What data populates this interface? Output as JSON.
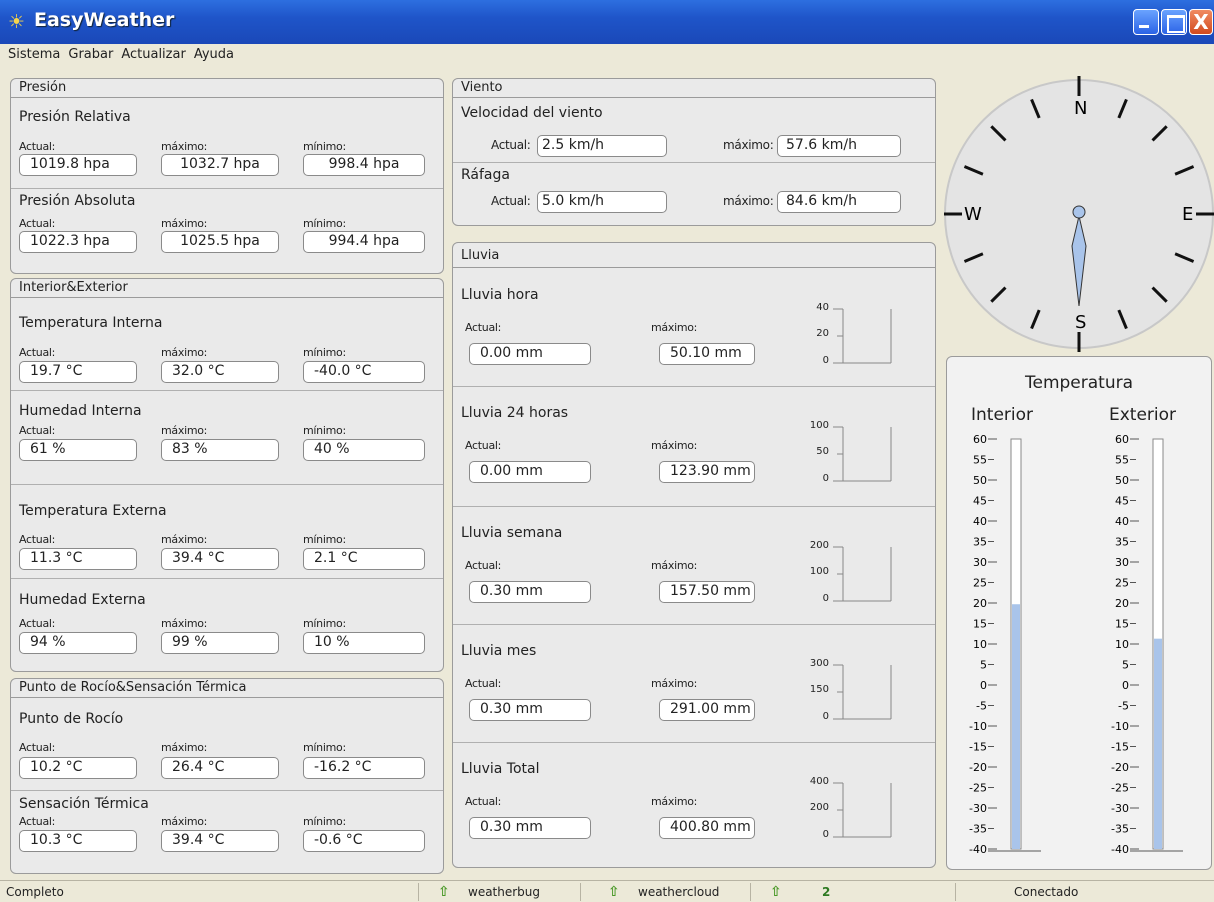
{
  "window": {
    "title": "EasyWeather",
    "close_glyph": "X"
  },
  "menu": [
    "Sistema",
    "Grabar",
    "Actualizar",
    "Ayuda"
  ],
  "labels": {
    "actual": "Actual:",
    "max": "máximo:",
    "min": "mínimo:"
  },
  "presion": {
    "title": "Presión",
    "relativa": {
      "title": "Presión Relativa",
      "actual": "1019.8 hpa",
      "max": "1032.7 hpa",
      "min": "998.4 hpa"
    },
    "absoluta": {
      "title": "Presión Absoluta",
      "actual": "1022.3 hpa",
      "max": "1025.5 hpa",
      "min": "994.4 hpa"
    }
  },
  "interior_exterior": {
    "title": "Interior&Exterior",
    "temp_int": {
      "title": "Temperatura Interna",
      "actual": "19.7 °C",
      "max": "32.0 °C",
      "min": "-40.0 °C"
    },
    "hum_int": {
      "title": "Humedad Interna",
      "actual": "61 %",
      "max": "83 %",
      "min": "40 %"
    },
    "temp_ext": {
      "title": "Temperatura Externa",
      "actual": "11.3 °C",
      "max": "39.4 °C",
      "min": "2.1 °C"
    },
    "hum_ext": {
      "title": "Humedad Externa",
      "actual": "94 %",
      "max": "99 %",
      "min": "10 %"
    }
  },
  "rocio": {
    "title": "Punto de Rocío&Sensación Térmica",
    "punto": {
      "title": "Punto de Rocío",
      "actual": "10.2 °C",
      "max": "26.4 °C",
      "min": "-16.2 °C"
    },
    "sensacion": {
      "title": "Sensación Térmica",
      "actual": "10.3 °C",
      "max": "39.4 °C",
      "min": "-0.6 °C"
    }
  },
  "viento": {
    "title": "Viento",
    "vel_title": "Velocidad del viento",
    "vel_actual": "2.5 km/h",
    "vel_max": "57.6 km/h",
    "raf_title": "Ráfaga",
    "raf_actual": "5.0 km/h",
    "raf_max": "84.6 km/h"
  },
  "lluvia": {
    "title": "Lluvia",
    "sections": [
      {
        "title": "Lluvia hora",
        "actual": "0.00 mm",
        "max": "50.10 mm",
        "scale": [
          "40",
          "20",
          "0"
        ]
      },
      {
        "title": "Lluvia 24 horas",
        "actual": "0.00 mm",
        "max": "123.90 mm",
        "scale": [
          "100",
          "50",
          "0"
        ]
      },
      {
        "title": "Lluvia semana",
        "actual": "0.30 mm",
        "max": "157.50 mm",
        "scale": [
          "200",
          "100",
          "0"
        ]
      },
      {
        "title": "Lluvia mes",
        "actual": "0.30 mm",
        "max": "291.00 mm",
        "scale": [
          "300",
          "150",
          "0"
        ]
      },
      {
        "title": "Lluvia Total",
        "actual": "0.30 mm",
        "max": "400.80 mm",
        "scale": [
          "400",
          "200",
          "0"
        ]
      }
    ]
  },
  "compass": {
    "n": "N",
    "s": "S",
    "e": "E",
    "w": "W"
  },
  "temperatura": {
    "title": "Temperatura",
    "interior_label": "Interior",
    "exterior_label": "Exterior",
    "scale": [
      "60",
      "55",
      "50",
      "45",
      "40",
      "35",
      "30",
      "25",
      "20",
      "15",
      "10",
      "5",
      "0",
      "-5",
      "-10",
      "-15",
      "-20",
      "-25",
      "-30",
      "-35",
      "-40"
    ],
    "interior_value": 19.7,
    "exterior_value": 11.3,
    "fill_color": "#a9c4ea"
  },
  "status": {
    "left": "Completo",
    "s1": "weatherbug",
    "s2": "weathercloud",
    "s3": "2",
    "right": "Conectado"
  }
}
